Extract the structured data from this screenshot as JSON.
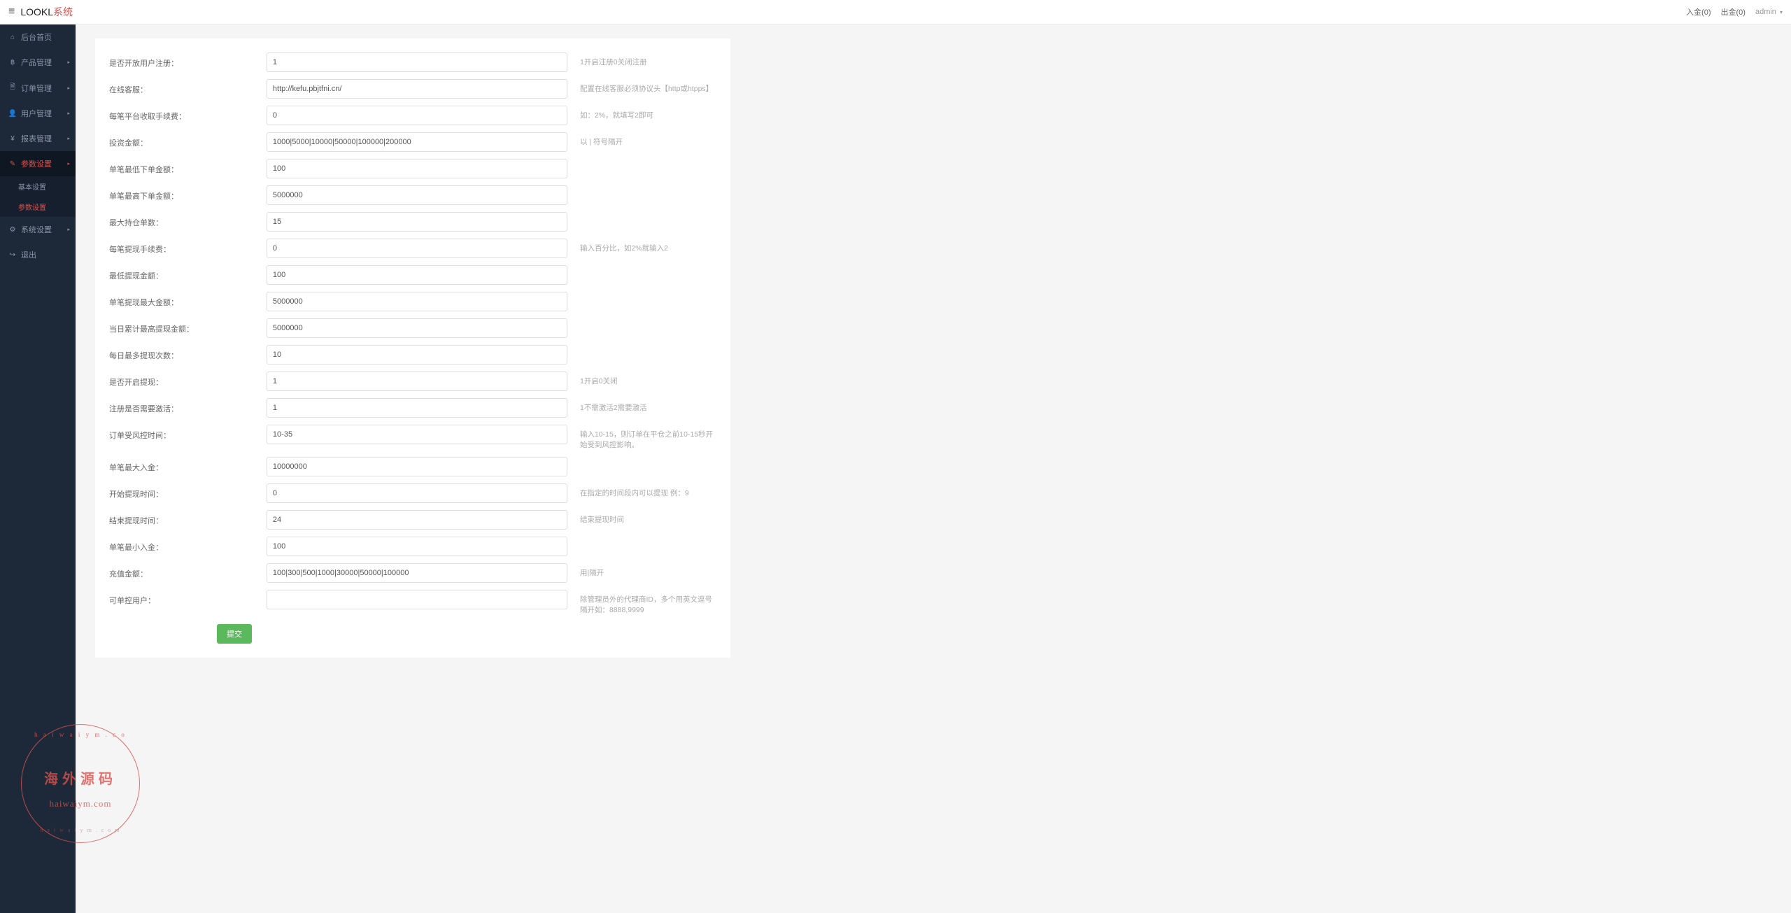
{
  "brand": {
    "dark": "LOOKL",
    "red": "系统"
  },
  "topbar": {
    "deposit": "入金(0)",
    "withdraw": "出金(0)",
    "user": "admin"
  },
  "sidebar": {
    "items": [
      {
        "icon": "⌂",
        "label": "后台首页",
        "caret": false
      },
      {
        "icon": "฿",
        "label": "产品管理",
        "caret": true
      },
      {
        "icon": "🗎",
        "label": "订单管理",
        "caret": true
      },
      {
        "icon": "👤",
        "label": "用户管理",
        "caret": true
      },
      {
        "icon": "¥",
        "label": "报表管理",
        "caret": true
      }
    ],
    "active": {
      "icon": "✎",
      "label": "参数设置"
    },
    "sub": [
      {
        "label": "基本设置",
        "active": false
      },
      {
        "label": "参数设置",
        "active": true
      }
    ],
    "after": [
      {
        "icon": "⚙",
        "label": "系统设置",
        "caret": true
      },
      {
        "icon": "↪",
        "label": "退出",
        "caret": false
      }
    ]
  },
  "form": {
    "rows": [
      {
        "label": "是否开放用户注册：",
        "value": "1",
        "help": "1开启注册0关闭注册"
      },
      {
        "label": "在线客服：",
        "value": "http://kefu.pbjtfni.cn/",
        "help": "配置在线客服必须协议头【http或htpps】"
      },
      {
        "label": "每笔平台收取手续费：",
        "value": "0",
        "help": "如：2%，就填写2即可"
      },
      {
        "label": "投资金额：",
        "value": "1000|5000|10000|50000|100000|200000",
        "help": "以 | 符号隔开"
      },
      {
        "label": "单笔最低下单金额：",
        "value": "100",
        "help": ""
      },
      {
        "label": "单笔最高下单金额：",
        "value": "5000000",
        "help": ""
      },
      {
        "label": "最大持仓单数：",
        "value": "15",
        "help": ""
      },
      {
        "label": "每笔提现手续费：",
        "value": "0",
        "help": "输入百分比，如2%就输入2"
      },
      {
        "label": "最低提现金额：",
        "value": "100",
        "help": ""
      },
      {
        "label": "单笔提现最大金额：",
        "value": "5000000",
        "help": ""
      },
      {
        "label": "当日累计最高提现金额：",
        "value": "5000000",
        "help": ""
      },
      {
        "label": "每日最多提现次数：",
        "value": "10",
        "help": ""
      },
      {
        "label": "是否开启提现：",
        "value": "1",
        "help": "1开启0关闭"
      },
      {
        "label": "注册是否需要激活：",
        "value": "1",
        "help": "1不需激活2需要激活"
      },
      {
        "label": "订单受风控时间：",
        "value": "10-35",
        "help": "输入10-15，则订单在平仓之前10-15秒开始受到风控影响。"
      },
      {
        "label": "单笔最大入金：",
        "value": "10000000",
        "help": ""
      },
      {
        "label": "开始提现时间：",
        "value": "0",
        "help": "在指定的时间段内可以提现 例：9"
      },
      {
        "label": "结束提现时间：",
        "value": "24",
        "help": "结束提现时间"
      },
      {
        "label": "单笔最小入金：",
        "value": "100",
        "help": ""
      },
      {
        "label": "充值金额：",
        "value": "100|300|500|1000|30000|50000|100000",
        "help": "用|隔开"
      },
      {
        "label": "可单控用户：",
        "value": "",
        "help": "除管理员外的代理商ID，多个用英文逗号隔开如：8888,9999"
      }
    ],
    "submit": "提交"
  },
  "watermark": {
    "arc_top": "h a i w a i y m . c o",
    "main": "海外源码",
    "url": "haiwaiym.com",
    "arc_bottom": "h a i w a i y m . c o m"
  }
}
